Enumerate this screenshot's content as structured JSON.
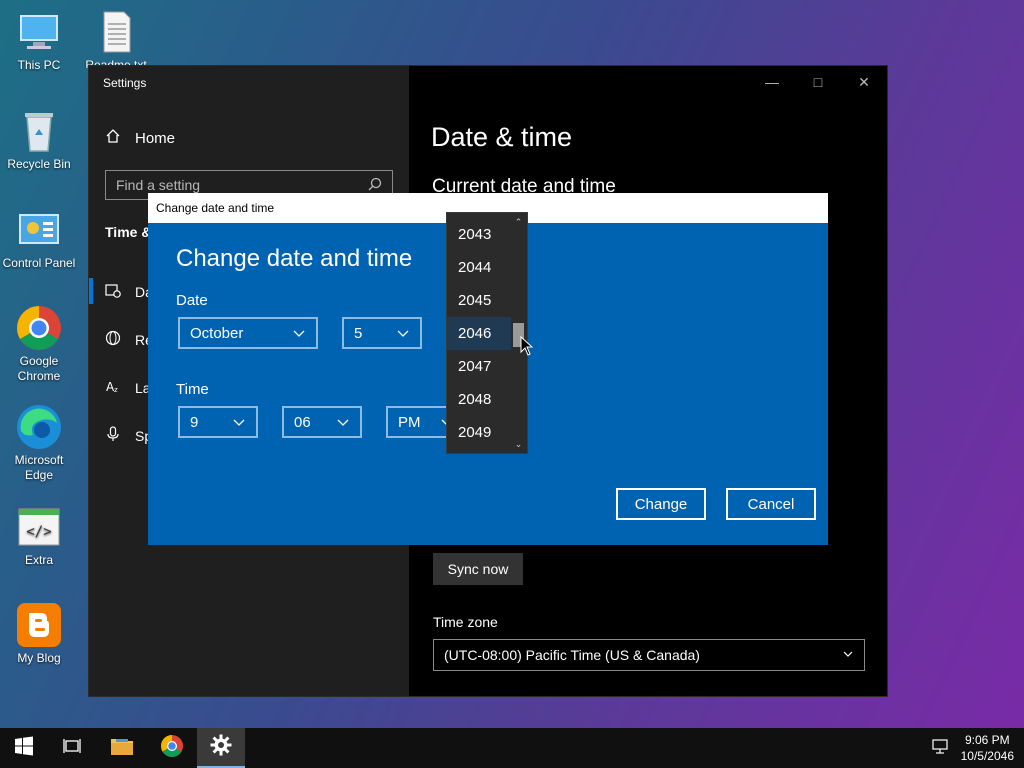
{
  "desktop": {
    "icons": [
      {
        "label": "This PC"
      },
      {
        "label": "Readme.txt"
      },
      {
        "label": "Recycle Bin"
      },
      {
        "label": "Control Panel"
      },
      {
        "label": "Google Chrome"
      },
      {
        "label": "Microsoft Edge"
      },
      {
        "label": "Extra"
      },
      {
        "label": "My Blog"
      }
    ]
  },
  "settings": {
    "window_title": "Settings",
    "home_label": "Home",
    "search_placeholder": "Find a setting",
    "section_label": "Time & Language",
    "nav": [
      {
        "label": "Date & time"
      },
      {
        "label": "Region"
      },
      {
        "label": "Language"
      },
      {
        "label": "Speech"
      }
    ],
    "page_title": "Date & time",
    "subheading": "Current date and time",
    "sync_button": "Sync now",
    "timezone_label": "Time zone",
    "timezone_value": "(UTC-08:00) Pacific Time (US & Canada)"
  },
  "dialog": {
    "window_title": "Change date and time",
    "heading": "Change date and time",
    "date_label": "Date",
    "month": "October",
    "day": "5",
    "time_label": "Time",
    "hour": "9",
    "minute": "06",
    "ampm": "PM",
    "change_button": "Change",
    "cancel_button": "Cancel",
    "year_options": [
      "2043",
      "2044",
      "2045",
      "2046",
      "2047",
      "2048",
      "2049"
    ],
    "selected_year": "2046"
  },
  "taskbar": {
    "time": "9:06 PM",
    "date": "10/5/2046"
  },
  "colors": {
    "dialog_blue": "#0063b1",
    "accent": "#0078d7",
    "sidebar": "#1f1f1f"
  }
}
